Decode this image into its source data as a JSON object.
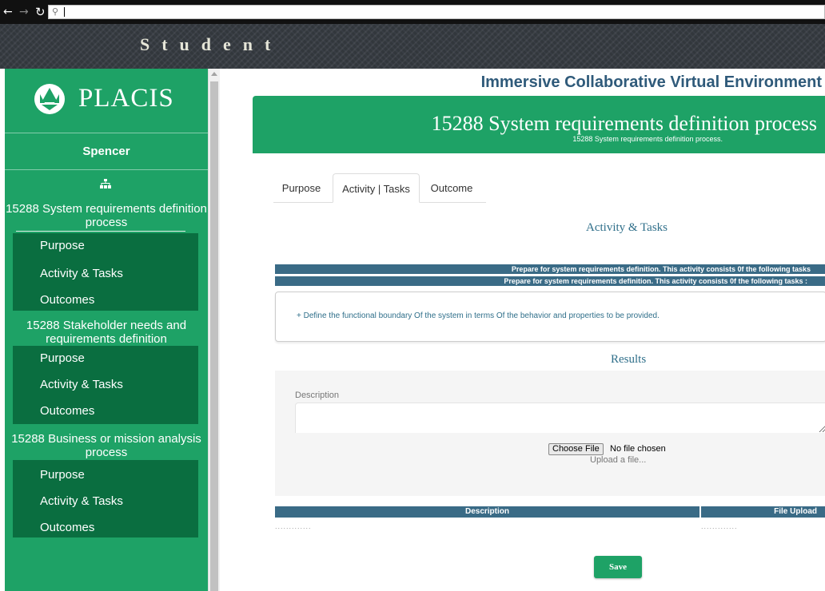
{
  "browser": {
    "back_icon": "arrow-left-icon",
    "forward_icon": "arrow-right-icon",
    "reload_icon": "reload-icon",
    "search_icon": "search-icon",
    "url": ""
  },
  "header": {
    "title": "Student"
  },
  "sidebar": {
    "logo_text": "PLACIS",
    "user": "Spencer",
    "sitemap_icon": "sitemap-icon",
    "groups": [
      {
        "title": "15288 System requirements definition process",
        "items": [
          "Purpose",
          "Activity & Tasks",
          "Outcomes"
        ]
      },
      {
        "title": "15288 Stakeholder needs and requirements definition",
        "items": [
          "Purpose",
          "Activity & Tasks",
          "Outcomes"
        ]
      },
      {
        "title": "15288 Business or mission analysis process",
        "items": [
          "Purpose",
          "Activity & Tasks",
          "Outcomes"
        ]
      }
    ]
  },
  "main": {
    "env_title": "Immersive Collaborative Virtual Environment",
    "banner_title": "15288 System requirements definition process",
    "banner_subtitle": "15288 System requirements definition process.",
    "tabs": [
      "Purpose",
      "Activity | Tasks",
      "Outcome"
    ],
    "active_tab": "Activity | Tasks",
    "activity_heading": "Activity & Tasks",
    "task_bar_1": "Prepare for system requirements definition. This activity consists 0f the following tasks",
    "task_bar_2": "Prepare for system requirements definition. This activity consists 0f the following tasks :",
    "task_item": "+ Define the functional boundary Of the system in terms Of the behavior and properties to be provided.",
    "results_heading": "Results",
    "description_label": "Description",
    "description_value": "",
    "file_button": "Choose File",
    "file_status": "No file chosen",
    "upload_hint": "Upload a file...",
    "table_headers": [
      "Description",
      "File Upload"
    ],
    "table_row": [
      ".............",
      "............."
    ],
    "save_label": "Save"
  },
  "colors": {
    "brand_green": "#1ea266",
    "dark_green": "#0a6e40",
    "table_header_blue": "#3a6b86",
    "title_blue": "#2f5a7a"
  }
}
